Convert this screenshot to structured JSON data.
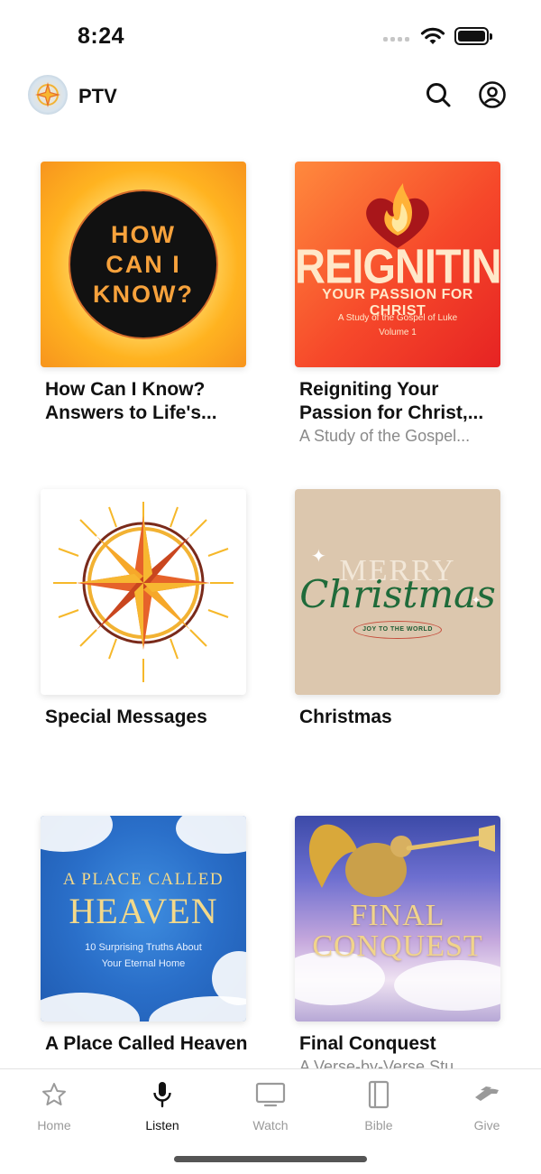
{
  "status_bar": {
    "time": "8:24"
  },
  "header": {
    "title": "PTV"
  },
  "grid": [
    {
      "title": "How Can I Know? Answers to Life's...",
      "subtitle": "",
      "art_lines": [
        "HOW",
        "CAN I",
        "KNOW?"
      ]
    },
    {
      "title": "Reigniting Your Passion for Christ,...",
      "subtitle": "A Study of the Gospel...",
      "art_big": "REIGNITING",
      "art_sub": "YOUR PASSION FOR CHRIST",
      "art_small1": "A Study of the Gospel of Luke",
      "art_small2": "Volume 1"
    },
    {
      "title": "Special Messages",
      "subtitle": ""
    },
    {
      "title": "Christmas",
      "subtitle": "",
      "art_merry": "MERRY",
      "art_christmas": "Christmas",
      "art_joy": "JOY TO THE WORLD"
    },
    {
      "title": "A Place Called Heaven",
      "subtitle": "",
      "art_t1": "A PLACE CALLED",
      "art_t2": "HEAVEN",
      "art_t3a": "10 Surprising Truths About",
      "art_t3b": "Your Eternal Home"
    },
    {
      "title": "Final Conquest",
      "subtitle": "A Verse-by-Verse Stu...",
      "art_l1": "FINAL",
      "art_l2": "CONQUEST"
    }
  ],
  "tabs": [
    {
      "label": "Home",
      "icon": "star-icon",
      "active": false
    },
    {
      "label": "Listen",
      "icon": "microphone-icon",
      "active": true
    },
    {
      "label": "Watch",
      "icon": "tv-icon",
      "active": false
    },
    {
      "label": "Bible",
      "icon": "book-icon",
      "active": false
    },
    {
      "label": "Give",
      "icon": "give-hand-icon",
      "active": false
    }
  ],
  "colors": {
    "accent": "#111111",
    "inactive": "#9a9a9a"
  }
}
